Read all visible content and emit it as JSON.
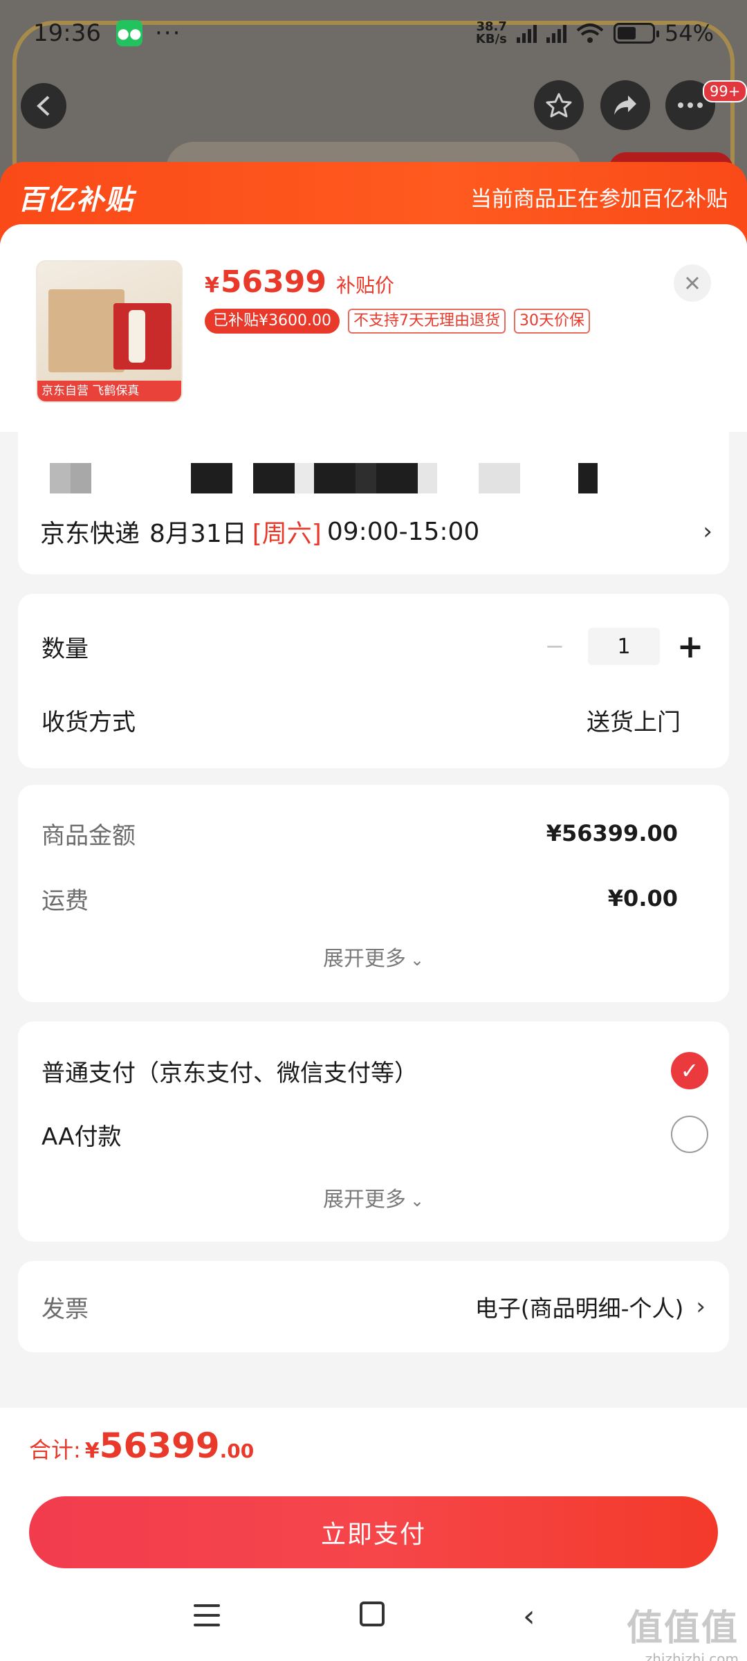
{
  "status_bar": {
    "time": "19:36",
    "dots": "···",
    "net_speed_top": "38.7",
    "net_speed_unit": "KB/s",
    "battery_pct": "54%",
    "battery_level": 0.54
  },
  "nav": {
    "more_badge": "99+"
  },
  "subsidy": {
    "logo": "百亿补贴",
    "note": "当前商品正在参加百亿补贴"
  },
  "product": {
    "thumb_tag": "京东自营 飞鹤保真",
    "price_symbol": "¥",
    "price": "56399",
    "price_label": "补贴价",
    "tags": [
      "已补贴¥3600.00",
      "不支持7天无理由退货",
      "30天价保"
    ]
  },
  "delivery": {
    "carrier": "京东快递",
    "date": "8月31日",
    "weekday": "[周六]",
    "time_window": "09:00-15:00"
  },
  "order": {
    "quantity_label": "数量",
    "quantity_value": "1",
    "receive_label": "收货方式",
    "receive_value": "送货上门"
  },
  "amounts": {
    "goods_label": "商品金额",
    "goods_value": "¥56399.00",
    "shipping_label": "运费",
    "shipping_value": "¥0.00",
    "expand_label": "展开更多"
  },
  "payment": {
    "option1": "普通支付（京东支付、微信支付等）",
    "option2": "AA付款",
    "expand_label": "展开更多"
  },
  "invoice": {
    "label": "发票",
    "value": "电子(商品明细-个人)"
  },
  "total": {
    "label": "合计:",
    "symbol": "¥",
    "main": "56399",
    "decimal": ".00"
  },
  "pay_button": "立即支付",
  "watermark": {
    "big": "值值值",
    "small": "zhizhizhi.com"
  },
  "colors": {
    "accent": "#e8392b",
    "subsidy_orange": "#fa4a18"
  }
}
